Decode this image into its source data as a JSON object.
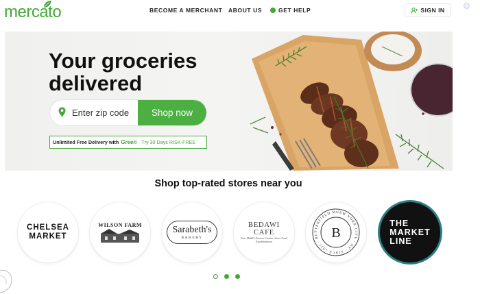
{
  "brand": {
    "logo_text": "mercato",
    "accent": "#43a838"
  },
  "nav": {
    "become_merchant": "BECOME A MERCHANT",
    "about_us": "ABOUT US",
    "get_help": "GET HELP",
    "sign_in": "SIGN IN",
    "sign_in_icon": "user-plus-icon"
  },
  "hero": {
    "title_line1": "Your groceries",
    "title_line2": "delivered",
    "zip_placeholder": "Enter zip code",
    "zip_icon": "location-pin-icon",
    "shop_now": "Shop now",
    "promo_main": "Unlimited Free Delivery with",
    "promo_green": "Green",
    "promo_try": "Try 30 Days RISK-FREE"
  },
  "stores_section": {
    "title": "Shop top-rated stores near you",
    "stores": [
      {
        "name_line1": "CHELSEA",
        "name_line2": "MARKET"
      },
      {
        "name": "WILSON FARM"
      },
      {
        "name": "Sarabeth's",
        "sub": "BAKERY"
      },
      {
        "name": "BEDAWI CAFE",
        "sub": "Fine Middle Eastern Cuisine Since Food Establishment"
      },
      {
        "name": "NEW YORK CITY · NY · SINCE 1931 · BUTTERFIELD MARKET",
        "monogram": "B"
      },
      {
        "name_line1": "THE",
        "name_line2": "MARKET",
        "name_line3": "LINE"
      }
    ],
    "carousel_pages": 3,
    "carousel_active": 1
  }
}
